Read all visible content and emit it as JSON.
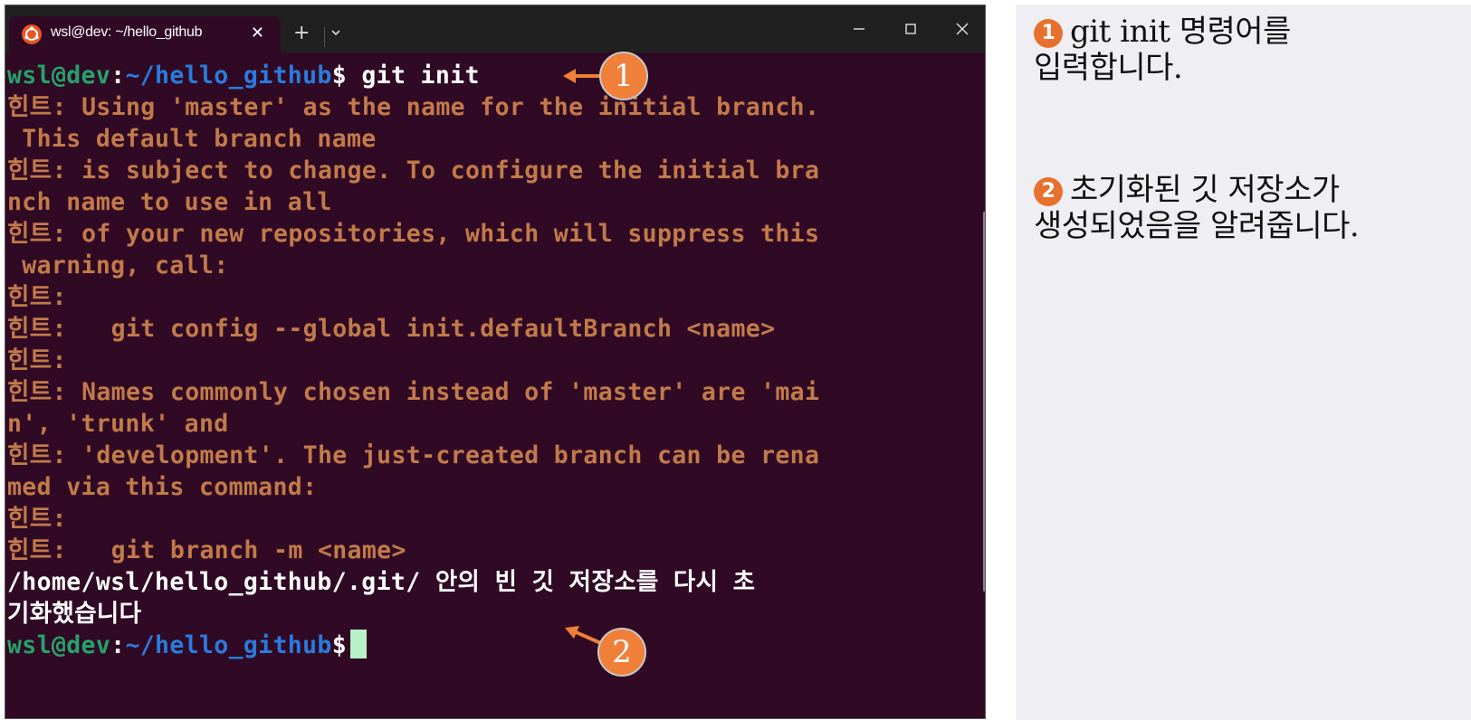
{
  "window": {
    "tab_title": "wsl@dev: ~/hello_github",
    "tab_close": "✕",
    "new_tab": "+",
    "icons": {
      "tab": "ubuntu-icon",
      "dropdown": "chevron-down-icon",
      "minimize": "minimize-icon",
      "maximize": "maximize-icon",
      "close": "close-icon"
    }
  },
  "terminal": {
    "prompt_user": "wsl@dev",
    "prompt_sep": ":",
    "prompt_path": "~/hello_github",
    "prompt_dollar": "$",
    "command": " git init",
    "hint_lines": [
      "힌트: Using 'master' as the name for the initial branch.",
      " This default branch name",
      "힌트: is subject to change. To configure the initial bra",
      "nch name to use in all",
      "힌트: of your new repositories, which will suppress this",
      " warning, call:",
      "힌트:",
      "힌트:   git config --global init.defaultBranch <name>",
      "힌트:",
      "힌트: Names commonly chosen instead of 'master' are 'mai",
      "n', 'trunk' and",
      "힌트: 'development'. The just-created branch can be rena",
      "med via this command:",
      "힌트:",
      "힌트:   git branch -m <name>"
    ],
    "result_lines": [
      "/home/wsl/hello_github/.git/ 안의 빈 깃 저장소를 다시 초",
      "기화했습니다"
    ]
  },
  "callouts": [
    {
      "number": "1"
    },
    {
      "number": "2"
    }
  ],
  "annotations": [
    {
      "badge": "1",
      "line1": "git init 명령어를",
      "line2": "입력합니다."
    },
    {
      "badge": "2",
      "line1": "초기화된 깃 저장소가",
      "line2": "생성되었음을 알려줍니다."
    }
  ],
  "colors": {
    "terminal_bg": "#300a24",
    "hint_text": "#c27a4a",
    "prompt_user": "#26a269",
    "prompt_path": "#2a7bde",
    "accent_orange": "#f07f3a",
    "panel_bg": "#efeff3"
  }
}
